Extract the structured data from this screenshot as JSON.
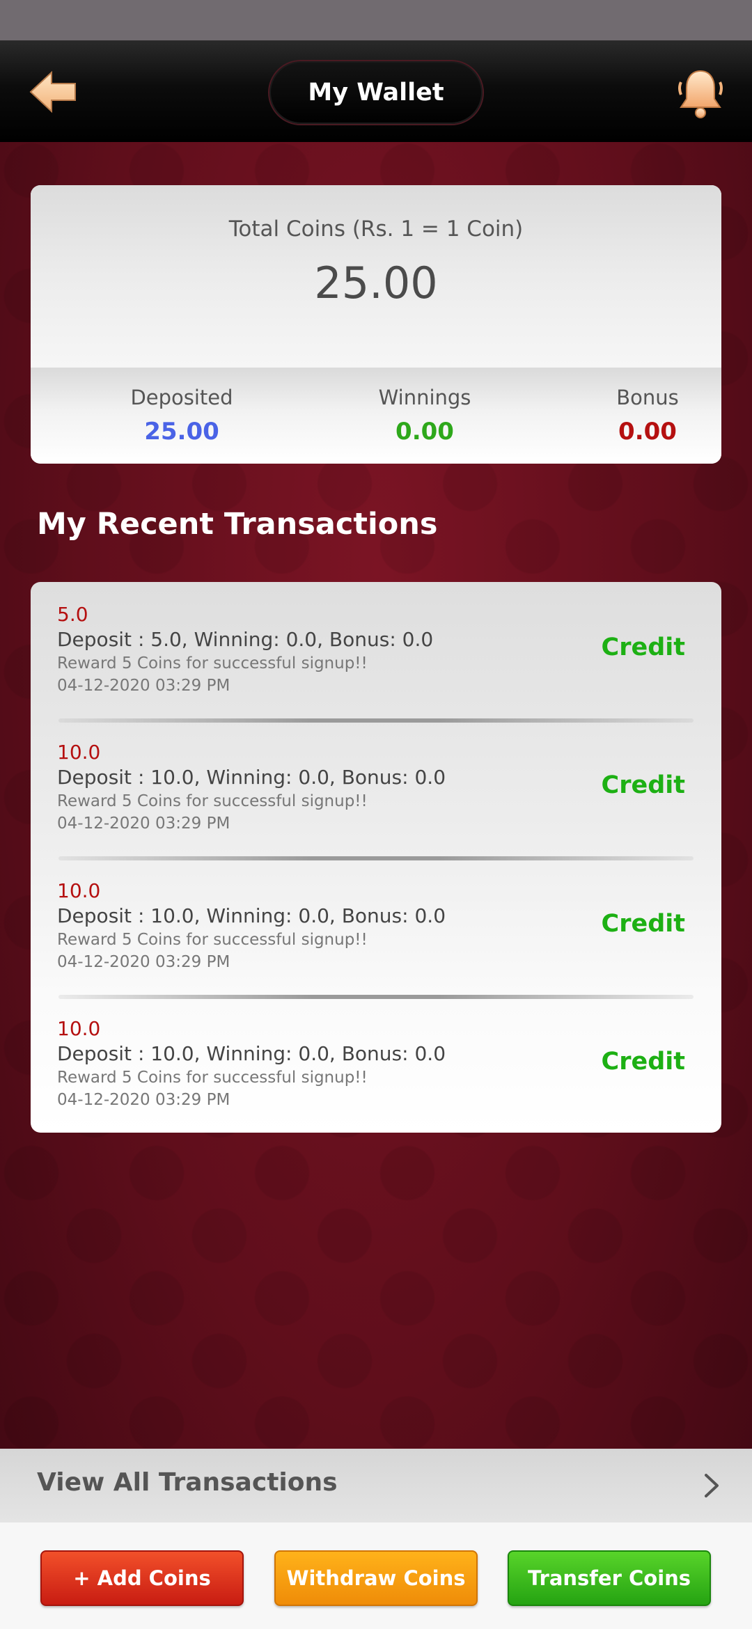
{
  "header": {
    "title": "My Wallet"
  },
  "summary": {
    "total_label": "Total Coins (Rs. 1 = 1 Coin)",
    "total_value": "25.00",
    "deposited_label": "Deposited",
    "deposited_value": "25.00",
    "winnings_label": "Winnings",
    "winnings_value": "0.00",
    "bonus_label": "Bonus",
    "bonus_value": "0.00",
    "colors": {
      "deposited": "#4a63e6",
      "winnings": "#2ea81b",
      "bonus": "#b51010"
    }
  },
  "transactions": {
    "section_title": "My Recent Transactions",
    "items": [
      {
        "amount": "5.0",
        "description": "Deposit : 5.0, Winning: 0.0, Bonus: 0.0",
        "note": "Reward 5 Coins for successful signup!!",
        "date": "04-12-2020 03:29 PM",
        "type": "Credit"
      },
      {
        "amount": "10.0",
        "description": "Deposit : 10.0, Winning: 0.0, Bonus: 0.0",
        "note": "Reward 5 Coins for successful signup!!",
        "date": "04-12-2020 03:29 PM",
        "type": "Credit"
      },
      {
        "amount": "10.0",
        "description": "Deposit : 10.0, Winning: 0.0, Bonus: 0.0",
        "note": "Reward 5 Coins for successful signup!!",
        "date": "04-12-2020 03:29 PM",
        "type": "Credit"
      },
      {
        "amount": "10.0",
        "description": "Deposit : 10.0, Winning: 0.0, Bonus: 0.0",
        "note": "Reward 5 Coins for successful signup!!",
        "date": "04-12-2020 03:29 PM",
        "type": "Credit"
      }
    ]
  },
  "view_all": {
    "label": "View All Transactions",
    "icon": "chevron-right-icon"
  },
  "actions": {
    "add_label": "+ Add Coins",
    "withdraw_label": "Withdraw Coins",
    "transfer_label": "Transfer Coins"
  },
  "icons": {
    "back": "back-arrow-icon",
    "notifications": "bell-icon"
  }
}
